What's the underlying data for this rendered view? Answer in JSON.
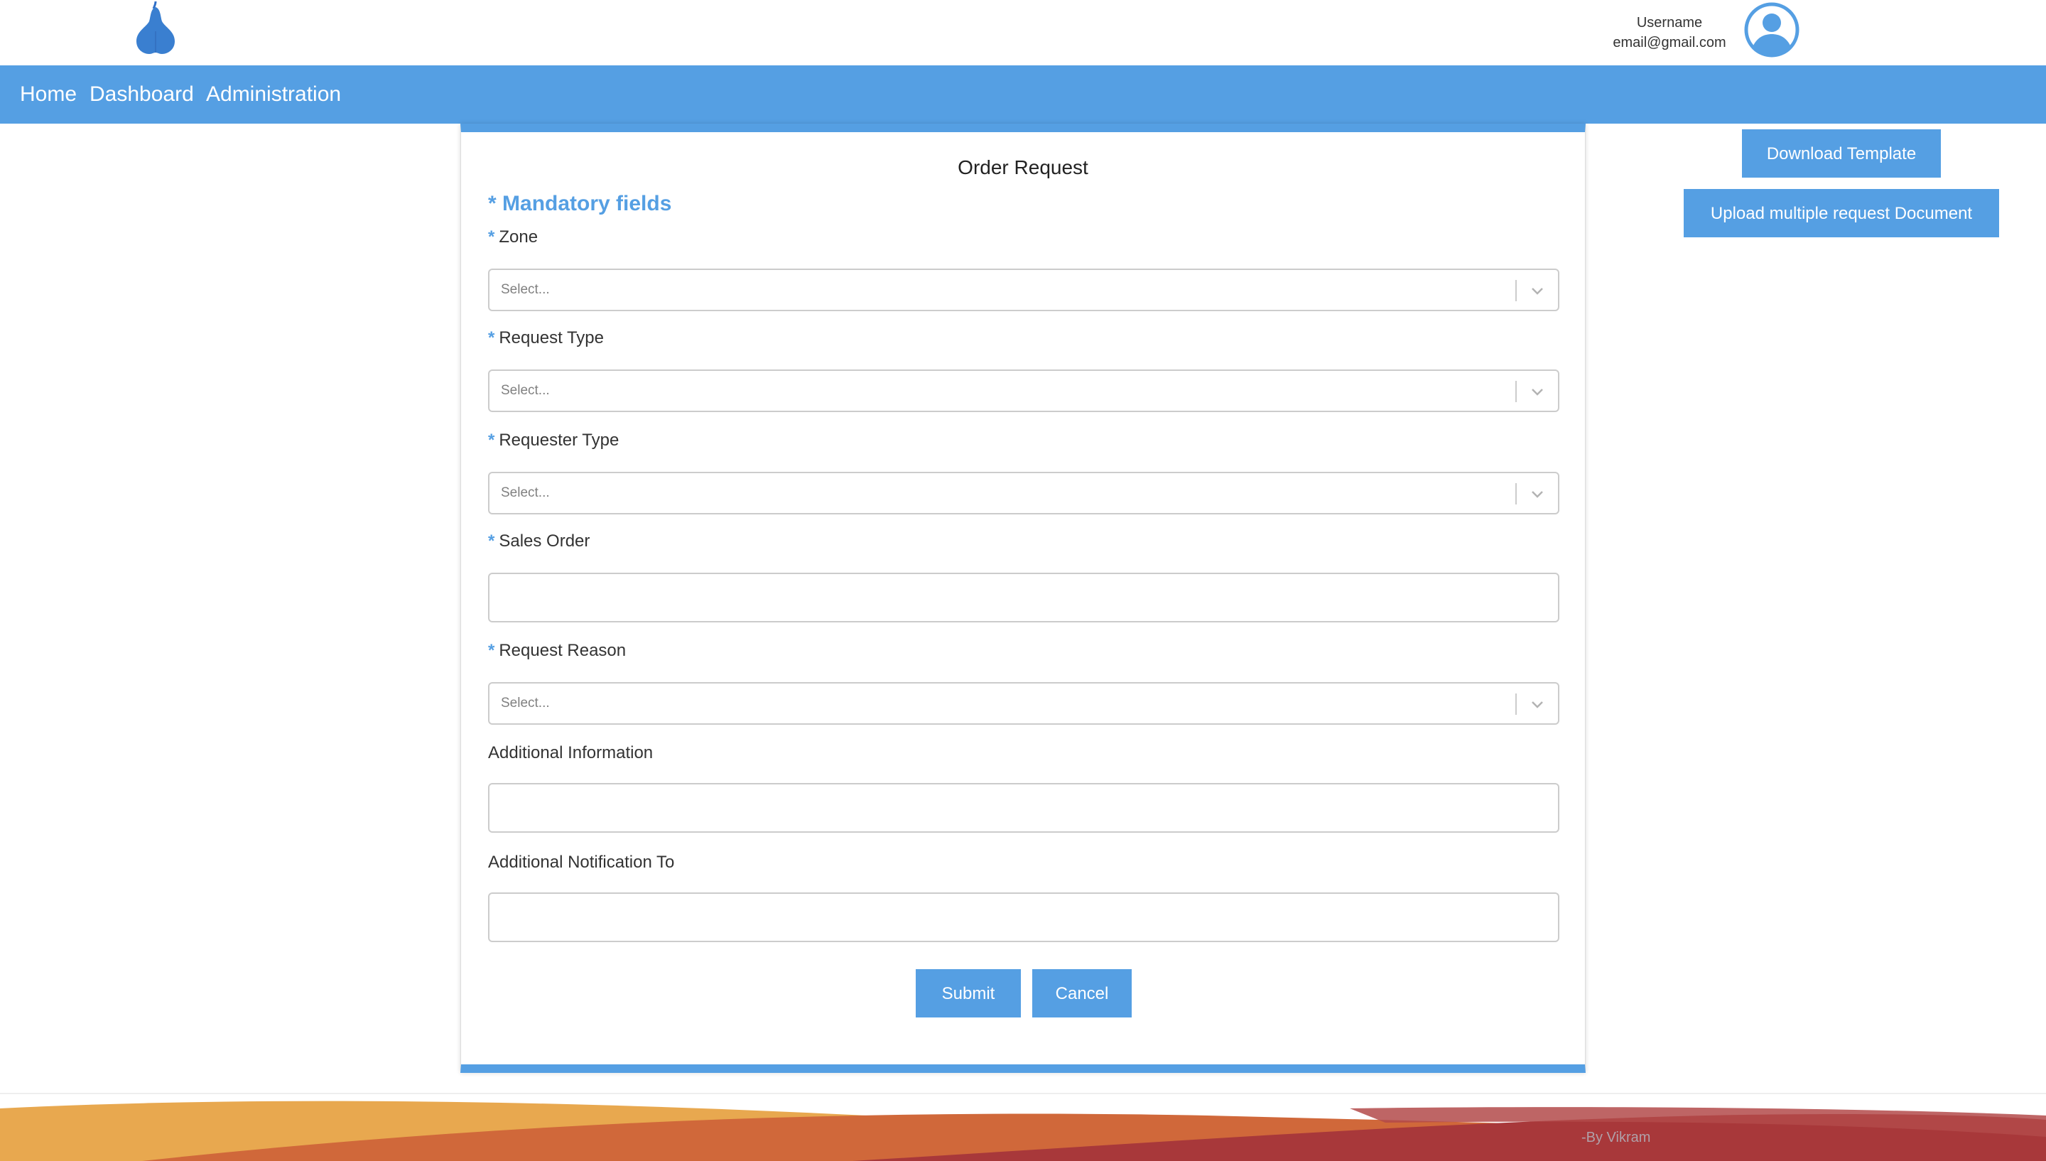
{
  "header": {
    "username": "Username",
    "email": "email@gmail.com",
    "logo_icon": "pear-icon",
    "avatar_icon": "user-avatar-icon"
  },
  "nav": {
    "items": [
      {
        "label": "Home"
      },
      {
        "label": "Dashboard"
      },
      {
        "label": "Administration"
      }
    ]
  },
  "actions": {
    "download_label": "Download Template",
    "upload_label": "Upload multiple request Document"
  },
  "form": {
    "title": "Order Request",
    "mandatory_note": "Mandatory fields",
    "required_marker": "*",
    "fields": {
      "zone": {
        "label": "Zone",
        "placeholder": "Select..."
      },
      "request_type": {
        "label": "Request Type",
        "placeholder": "Select..."
      },
      "requester_type": {
        "label": "Requester Type",
        "placeholder": "Select..."
      },
      "sales_order": {
        "label": "Sales Order",
        "value": ""
      },
      "request_reason": {
        "label": "Request Reason",
        "placeholder": "Select..."
      },
      "additional_information": {
        "label": "Additional Information",
        "value": ""
      },
      "additional_notification": {
        "label": "Additional Notification To",
        "value": ""
      }
    },
    "submit_label": "Submit",
    "cancel_label": "Cancel"
  },
  "footer": {
    "credit": "-By Vikram"
  },
  "colors": {
    "accent": "#559fe3",
    "footer_wave_1": "#e8a84f",
    "footer_wave_2": "#d0683a",
    "footer_wave_3": "#a8383a"
  }
}
